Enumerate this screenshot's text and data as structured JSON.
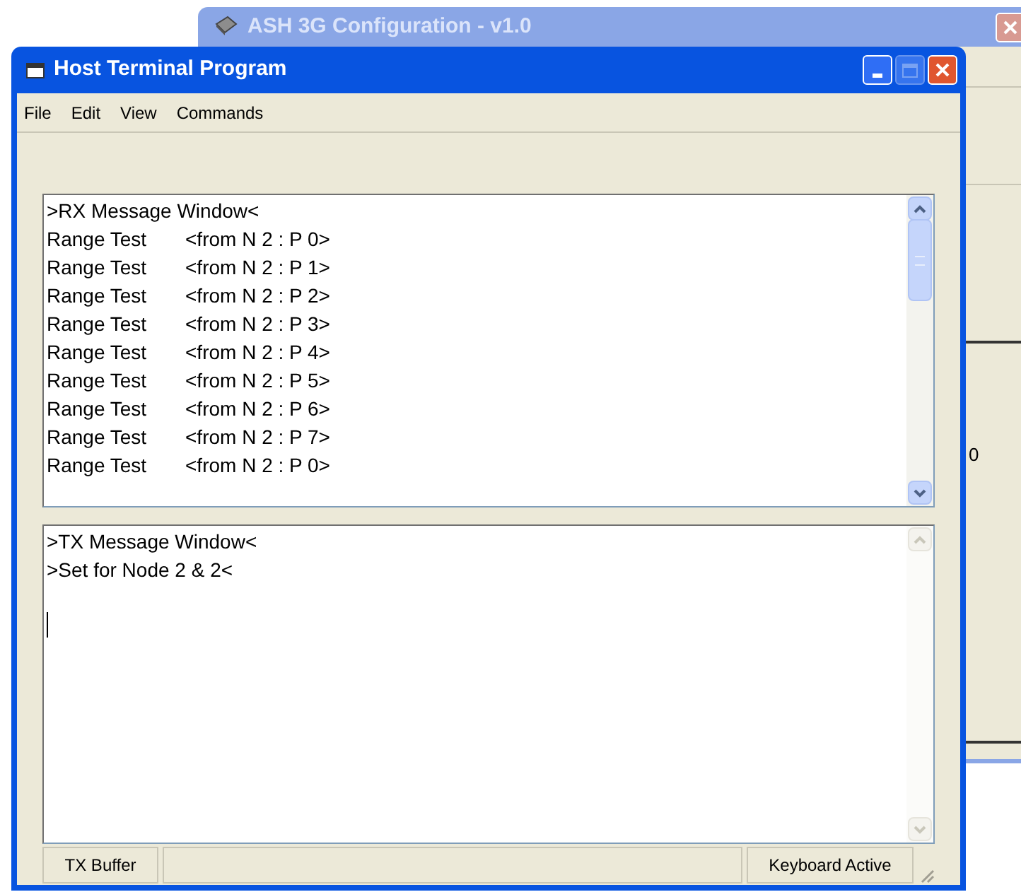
{
  "background_window": {
    "title": "ASH 3G Configuration - v1.0",
    "fragment": "0"
  },
  "window": {
    "title": "Host Terminal Program",
    "active": true
  },
  "menu": [
    {
      "label": "File"
    },
    {
      "label": "Edit"
    },
    {
      "label": "View"
    },
    {
      "label": "Commands"
    }
  ],
  "rx_window": {
    "header": ">RX Message Window<",
    "scroll_enabled": true,
    "lines": [
      {
        "label": "Range Test",
        "source": "<from N 2 : P 0>"
      },
      {
        "label": "Range Test",
        "source": "<from N 2 : P 1>"
      },
      {
        "label": "Range Test",
        "source": "<from N 2 : P 2>"
      },
      {
        "label": "Range Test",
        "source": "<from N 2 : P 3>"
      },
      {
        "label": "Range Test",
        "source": "<from N 2 : P 4>"
      },
      {
        "label": "Range Test",
        "source": "<from N 2 : P 5>"
      },
      {
        "label": "Range Test",
        "source": "<from N 2 : P 6>"
      },
      {
        "label": "Range Test",
        "source": "<from N 2 : P 7>"
      },
      {
        "label": "Range Test",
        "source": "<from N 2 : P 0>"
      }
    ]
  },
  "tx_window": {
    "scroll_enabled": false,
    "lines": [
      ">TX Message Window<",
      ">Set for Node 2 & 2<"
    ]
  },
  "status_bar": {
    "left": "TX Buffer",
    "right": "Keyboard Active"
  }
}
